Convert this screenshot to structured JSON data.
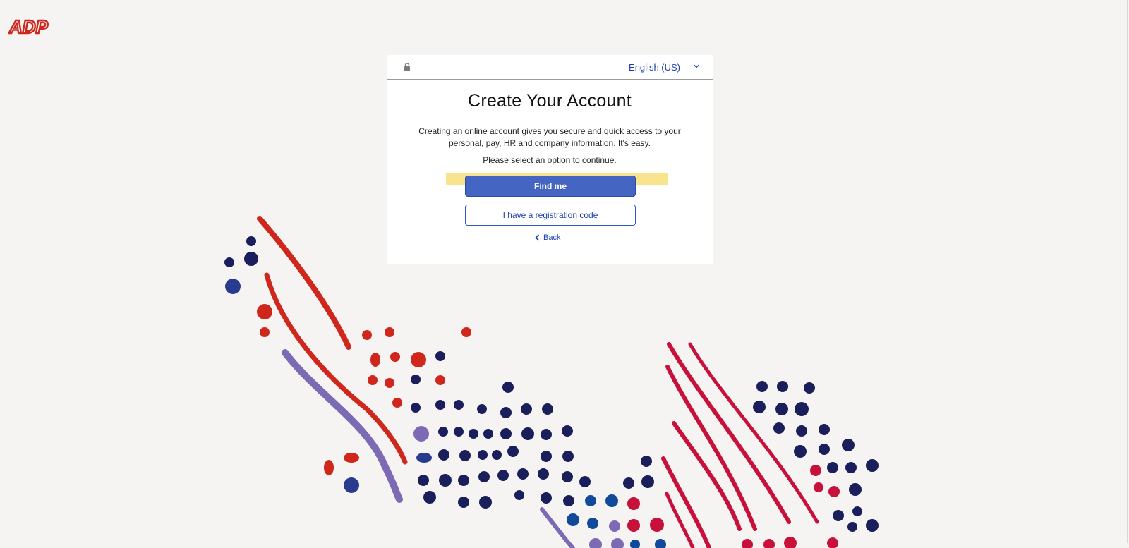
{
  "brand": {
    "logo_text": "ADP"
  },
  "card": {
    "language": "English (US)",
    "title": "Create Your Account",
    "description": "Creating an online account gives you secure and quick access to your personal, pay, HR and company information. It's easy.",
    "prompt": "Please select an option to continue.",
    "find_me_label": "Find me",
    "registration_label": "I have a registration code",
    "back_label": "Back"
  },
  "colors": {
    "page_bg": "#f6f4f3",
    "brand_red": "#d0271d",
    "primary_blue": "#4565c2",
    "link_blue": "#1d3fae",
    "dot_navy": "#1a1f5b",
    "dot_red": "#d0271d",
    "crimson": "#c8113a",
    "purple": "#7d6ab4",
    "highlight": "#f8df7a"
  },
  "icons": {
    "lock": "lock-icon",
    "chevron": "chevron-down-icon",
    "back": "chevron-left-icon"
  }
}
